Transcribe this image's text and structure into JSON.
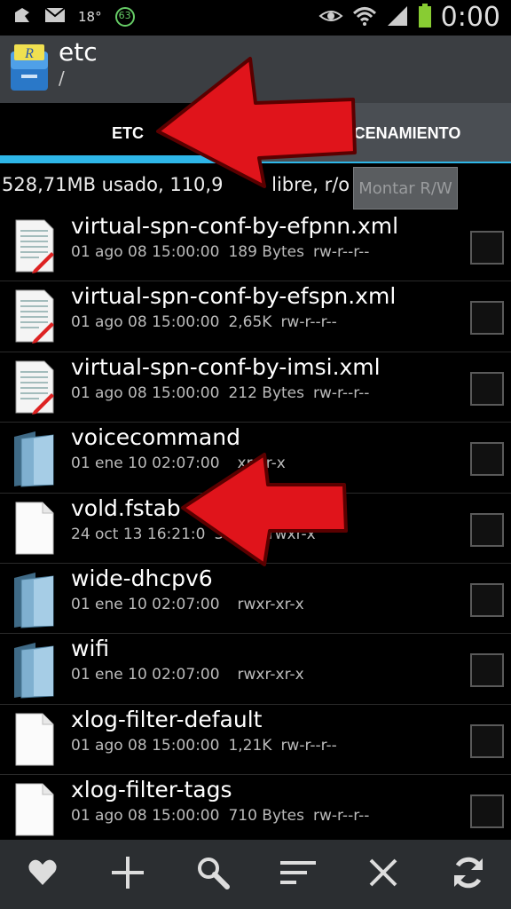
{
  "status_bar": {
    "temperature": "18°",
    "badge": "63",
    "clock": "0:00"
  },
  "header": {
    "title": "etc",
    "subtitle": "/"
  },
  "tabs": [
    {
      "label": "ETC",
      "selected": true
    },
    {
      "label": "ALMACENAMIENTO",
      "selected": false
    }
  ],
  "usage": {
    "text": "528,71MB usado, 110,9",
    "text_after": " libre, r/o",
    "mount_button": "Montar R/W"
  },
  "files": [
    {
      "name": "virtual-spn-conf-by-efpnn.xml",
      "date": "01 ago 08 15:00:00",
      "size": "189 Bytes",
      "perms": "rw-r--r--",
      "kind": "text-file"
    },
    {
      "name": "virtual-spn-conf-by-efspn.xml",
      "date": "01 ago 08 15:00:00",
      "size": "2,65K",
      "perms": "rw-r--r--",
      "kind": "text-file"
    },
    {
      "name": "virtual-spn-conf-by-imsi.xml",
      "date": "01 ago 08 15:00:00",
      "size": "212 Bytes",
      "perms": "rw-r--r--",
      "kind": "text-file"
    },
    {
      "name": "voicecommand",
      "date": "01 ene 10 02:07:00",
      "size": "",
      "perms": "xr-xr-x",
      "kind": "folder"
    },
    {
      "name": "vold.fstab",
      "date": "24 oct 13 16:21:0",
      "size": "30K",
      "perms": "---rwxr-x",
      "kind": "blank-file"
    },
    {
      "name": "wide-dhcpv6",
      "date": "01 ene 10 02:07:00",
      "size": "",
      "perms": "rwxr-xr-x",
      "kind": "folder"
    },
    {
      "name": "wifi",
      "date": "01 ene 10 02:07:00",
      "size": "",
      "perms": "rwxr-xr-x",
      "kind": "folder"
    },
    {
      "name": "xlog-filter-default",
      "date": "01 ago 08 15:00:00",
      "size": "1,21K",
      "perms": "rw-r--r--",
      "kind": "blank-file"
    },
    {
      "name": "xlog-filter-tags",
      "date": "01 ago 08 15:00:00",
      "size": "710 Bytes",
      "perms": "rw-r--r--",
      "kind": "blank-file"
    }
  ],
  "toolbar": [
    {
      "icon": "heart-icon"
    },
    {
      "icon": "plus-icon"
    },
    {
      "icon": "search-icon"
    },
    {
      "icon": "sort-icon"
    },
    {
      "icon": "close-icon"
    },
    {
      "icon": "refresh-icon"
    }
  ],
  "colors": {
    "accent": "#2eb6e8",
    "annotation_arrow": "#e0141b"
  }
}
